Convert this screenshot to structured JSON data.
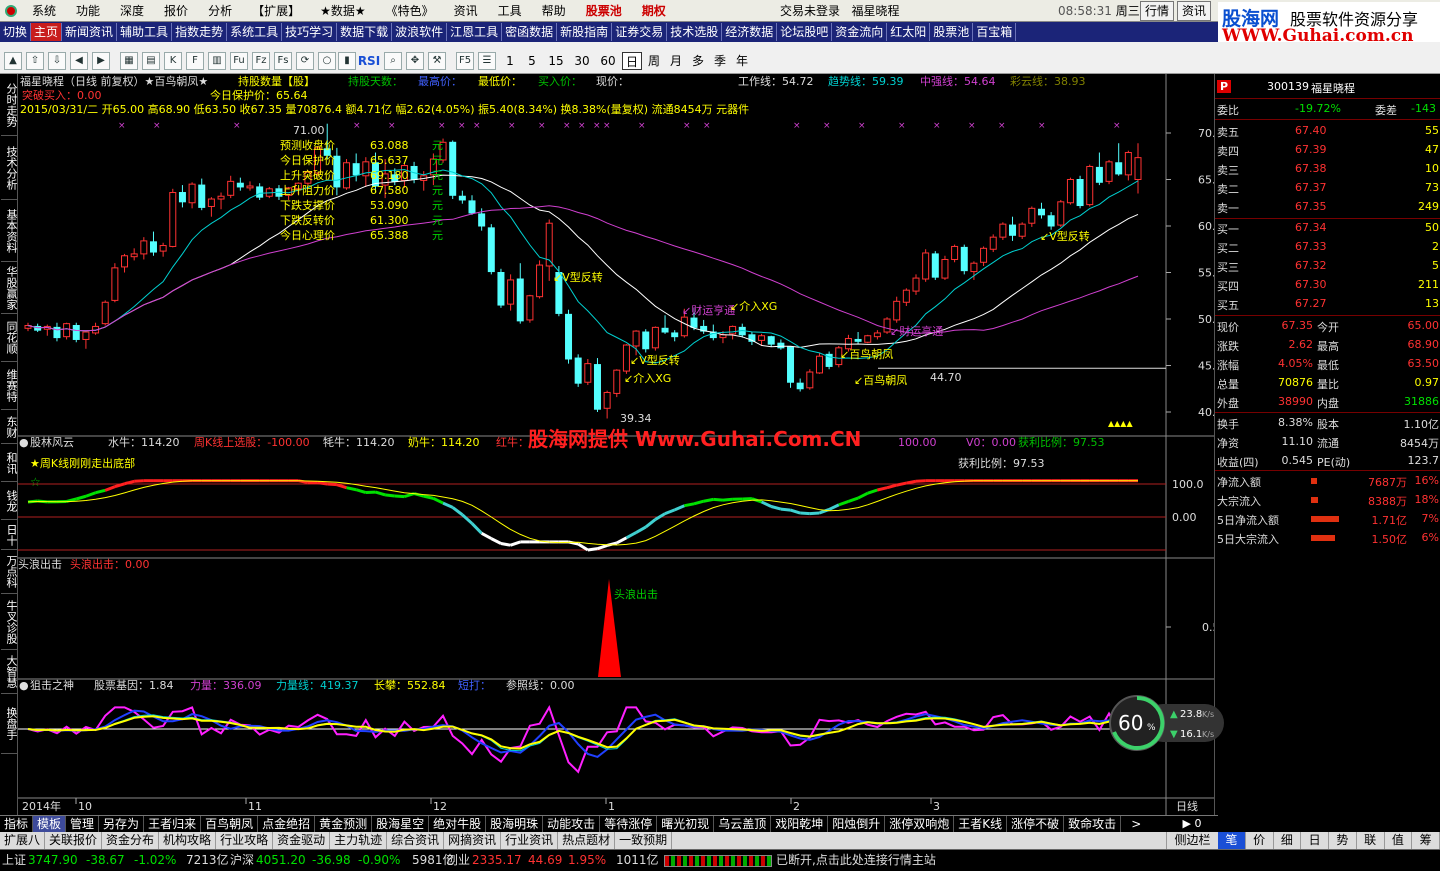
{
  "menubar": {
    "items": [
      "系统",
      "功能",
      "深度",
      "报价",
      "分析",
      "【扩展】",
      "★数据★",
      "《特色》",
      "资讯",
      "工具",
      "帮助",
      "股票池",
      "期权"
    ],
    "status": "交易未登录",
    "stock": "福星晓程",
    "time": "08:58:31",
    "weekday": "周三",
    "btn_quote": "行情",
    "btn_news": "资讯"
  },
  "brand": {
    "name_cn": "股海网",
    "tagline": "股票软件资源分享",
    "url": "WWW.Guhai.com.cn"
  },
  "navbar": {
    "items": [
      "切换",
      "主页",
      "新闻资讯",
      "辅助工具",
      "指数走势",
      "系统工具",
      "技巧学习",
      "数据下载",
      "波浪软件",
      "江恩工具",
      "密函数据",
      "新股指南",
      "证券交易",
      "技术选股",
      "经济数据",
      "论坛股吧",
      "资金流向",
      "红太阳",
      "股票池",
      "百宝箱"
    ],
    "active_index": 1
  },
  "toolbar": {
    "periods": [
      "1",
      "5",
      "15",
      "30",
      "60",
      "日",
      "周",
      "月",
      "多",
      "季",
      "年"
    ],
    "selected_period": "日",
    "rsi_label": "RSI"
  },
  "sidetabs": [
    "分时走势",
    "技术分析",
    "基本资料",
    "华股赢家",
    "同花顺",
    "维赛特",
    "东财",
    "和讯",
    "钱龙",
    "日十",
    "万点科",
    "牛叉诊股",
    "大智慧",
    "换盘手"
  ],
  "main_panel": {
    "title": "福星晓程（日线 前复权）★百鸟朝凤★",
    "hold_label": "持股数量【股】",
    "hold_days": "持股天数：",
    "highest": "最高价：",
    "lowest": "最低价：",
    "buy_price": "买入价：",
    "now_price": "现价：",
    "work_line": "工作线：54.72",
    "trend_line": "趋势线：59.39",
    "mid_line": "中强线：54.64",
    "color_line": "彩云线：38.93",
    "break_buy": "突破买入：0.00",
    "today_protect": "今日保护价：65.64",
    "ohlc": "2015/03/31/二 开65.00 高68.90 低63.50 收67.35 量70876.4 额4.71亿 幅2.62(4.05%) 振5.40(8.34%) 换8.38%(量复权) 流通8454万 元器件",
    "yaxis": [
      "70.00",
      "65.00",
      "60.00",
      "55.00",
      "50.00",
      "45.00",
      "40.00"
    ],
    "max_label": "71.00",
    "min_label": "39.34",
    "level_label": "44.70",
    "predict_labels": [
      "预测收盘价",
      "今日保护价",
      "上升突破价",
      "上升阻力价",
      "下跌支撑价",
      "下跌反转价",
      "今日心理价"
    ],
    "predict_values": [
      "63.088",
      "65.637",
      "69.180",
      "67.580",
      "53.090",
      "61.300",
      "65.388"
    ],
    "predict_unit": "元",
    "signals": [
      "V型反转",
      "V型反转",
      "V型反转",
      "财运亨通",
      "财运亨通",
      "介入XG",
      "介入XG",
      "百鸟朝凤",
      "百鸟朝凤"
    ]
  },
  "panel2": {
    "title": "股林风云",
    "shui": "水牛：114.20",
    "zhou": "周K线上选股：-100.00",
    "mao": "牦牛：114.20",
    "nai": "奶牛：114.20",
    "hong": "红牛：",
    "huo": "获利比例：97.53",
    "huo_line": "获利比例：97.53",
    "v0": "V0：0.00",
    "hundred": "100.00",
    "zero": "0.00",
    "hist": "★周K线刚刚走出底部",
    "watermark": "股海网提供 Www.Guhai.Com.CN",
    "yaxis": [
      "100.0",
      "0.00"
    ]
  },
  "panel3": {
    "title": "头浪出击",
    "value": "头浪出击：0.00",
    "signal": "头浪出击",
    "yaxis": "0.50"
  },
  "panel4": {
    "title": "狙击之神",
    "gene": "股票基因：1.84",
    "force": "力量：336.09",
    "force_line": "力量线：419.37",
    "long": "长攀：552.84",
    "short": "短打：",
    "ref": "参照线：0.00"
  },
  "xaxis": {
    "labels": [
      "2014年",
      "10",
      "11",
      "12",
      "1",
      "2",
      "3"
    ],
    "right": "日线"
  },
  "speed": {
    "percent": "60",
    "unit": "%",
    "up": "23.8",
    "down": "16.1",
    "rate_unit": "K/s"
  },
  "quote": {
    "code": "300139",
    "name": "福星晓程",
    "weibi_label": "委比",
    "weibi": "-19.72%",
    "weicha_label": "委差",
    "weicha": "-143",
    "sells": [
      {
        "l": "卖五",
        "p": "67.40",
        "v": "55"
      },
      {
        "l": "卖四",
        "p": "67.39",
        "v": "47"
      },
      {
        "l": "卖三",
        "p": "67.38",
        "v": "10"
      },
      {
        "l": "卖二",
        "p": "67.37",
        "v": "73"
      },
      {
        "l": "卖一",
        "p": "67.35",
        "v": "249"
      }
    ],
    "buys": [
      {
        "l": "买一",
        "p": "67.34",
        "v": "50"
      },
      {
        "l": "买二",
        "p": "67.33",
        "v": "2"
      },
      {
        "l": "买三",
        "p": "67.32",
        "v": "5"
      },
      {
        "l": "买四",
        "p": "67.30",
        "v": "211"
      },
      {
        "l": "买五",
        "p": "67.27",
        "v": "13"
      }
    ],
    "stats": [
      {
        "l": "现价",
        "v": "67.35",
        "l2": "今开",
        "v2": "65.00"
      },
      {
        "l": "涨跌",
        "v": "2.62",
        "l2": "最高",
        "v2": "68.90"
      },
      {
        "l": "涨幅",
        "v": "4.05%",
        "l2": "最低",
        "v2": "63.50"
      },
      {
        "l": "总量",
        "v": "70876",
        "l2": "量比",
        "v2": "0.97"
      },
      {
        "l": "外盘",
        "v": "38990",
        "l2": "内盘",
        "v2": "31886"
      }
    ],
    "stats2": [
      {
        "l": "换手",
        "v": "8.38%",
        "l2": "股本",
        "v2": "1.10亿"
      },
      {
        "l": "净资",
        "v": "11.10",
        "l2": "流通",
        "v2": "8454万"
      },
      {
        "l": "收益(四)",
        "v": "0.545",
        "l2": "PE(动)",
        "v2": "123.7"
      }
    ],
    "flows": [
      {
        "l": "净流入额",
        "v": "7687万",
        "p": "16%",
        "bar": 0.16
      },
      {
        "l": "大宗流入",
        "v": "8388万",
        "p": "18%",
        "bar": 0.18
      },
      {
        "l": "5日净流入额",
        "v": "1.71亿",
        "p": "7%",
        "bar": 0.7
      },
      {
        "l": "5日大宗流入",
        "v": "1.50亿",
        "p": "6%",
        "bar": 0.6
      }
    ]
  },
  "bottom_tabs1": [
    "指标",
    "模板",
    "管理",
    "另存为",
    "王者归来",
    "百鸟朝凤",
    "点金绝招",
    "黄金预测",
    "股海星空",
    "绝对牛股",
    "股海明珠",
    "动能攻击",
    "等待涨停",
    "曙光初现",
    "乌云盖顶",
    "戏阳乾坤",
    "阳烛倒升",
    "涨停双响炮",
    "王者K线",
    "涨停不破",
    "致命攻击"
  ],
  "bottom_tabs2": [
    "扩展八",
    "关联报价",
    "资金分布",
    "机构攻略",
    "行业攻略",
    "资金驱动",
    "主力轨迹",
    "综合资讯",
    "网摘资讯",
    "行业资讯",
    "热点题材",
    "一致预期"
  ],
  "right_tabs": [
    "笔",
    "价",
    "细",
    "日",
    "势",
    "联",
    "值",
    "筹"
  ],
  "right_small": "侧边栏",
  "status": {
    "sh_label": "上证",
    "sh": "3747.90",
    "sh_ch": "-38.67",
    "sh_pct": "-1.02%",
    "sh_amt": "7213亿",
    "sz_label": "沪深",
    "sz": "4051.20",
    "sz_ch": "-36.98",
    "sz_pct": "-0.90%",
    "sz_amt": "5981亿",
    "cy_label": "创业",
    "cy": "2335.17",
    "cy_ch": "44.69",
    "cy_pct": "1.95%",
    "cy_amt": "1011亿",
    "msg": "已断开,点击此处连接行情主站"
  },
  "colors": {
    "up": "#ff3232",
    "down": "#54ffff",
    "ma_white": "#ffffff",
    "ma_cyan": "#00d0d0",
    "ma_magenta": "#d040d0",
    "yellow": "#ffff00",
    "nav_bg": "#1b2478"
  }
}
